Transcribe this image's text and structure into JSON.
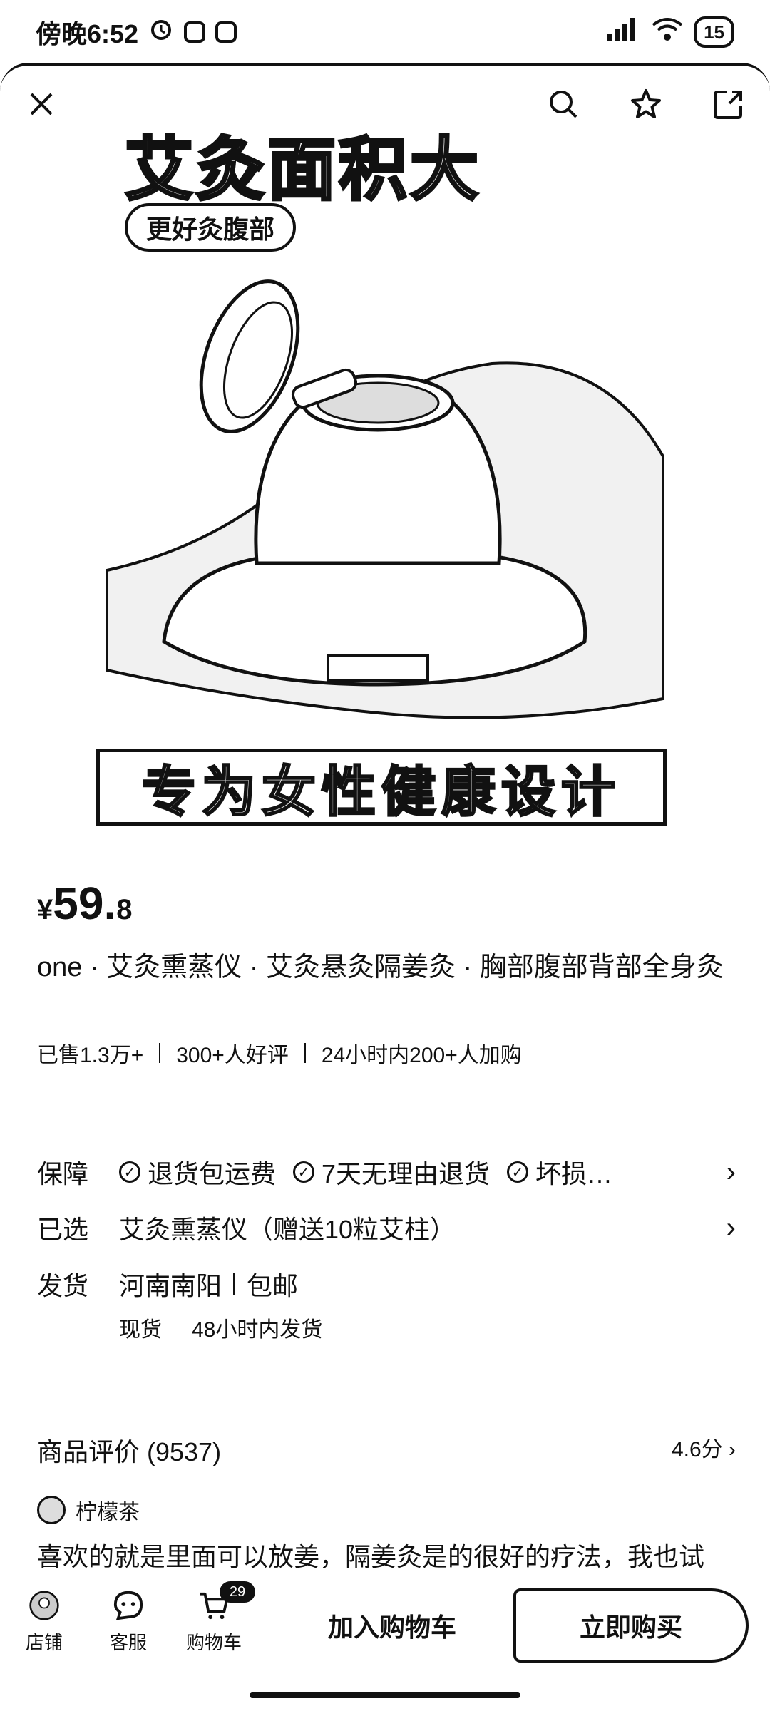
{
  "status_bar": {
    "time": "傍晚6:52",
    "battery": "15"
  },
  "hero": {
    "title": "艾灸面积大",
    "tag": "更好灸腹部",
    "banner": "专为女性健康设计"
  },
  "price": {
    "currency": "¥",
    "integer": "59.",
    "decimal": "8"
  },
  "product": {
    "title": "one · 艾灸熏蒸仪 · 艾灸悬灸隔姜灸 · 胸部腹部背部全身灸",
    "sold": "已售1.3万+",
    "good_reviews": "300+人好评",
    "added_24h": "24小时内200+人加购"
  },
  "guarantee": {
    "label": "保障",
    "items": [
      "退货包运费",
      "7天无理由退货",
      "坏损…"
    ]
  },
  "selected": {
    "label": "已选",
    "value": "艾灸熏蒸仪（赠送10粒艾柱）"
  },
  "shipping": {
    "label": "发货",
    "origin": "河南南阳",
    "fee": "包邮",
    "stock": "现货",
    "ship_time": "48小时内发货"
  },
  "reviews": {
    "title": "商品评价 (9537)",
    "score": "4.6分",
    "reviewer": "柠檬茶",
    "text": "喜欢的就是里面可以放姜，隔姜灸是的很好的疗法，我也试"
  },
  "bottom_bar": {
    "store": "店铺",
    "service": "客服",
    "cart": "购物车",
    "cart_count": "29",
    "add_to_cart": "加入购物车",
    "buy_now": "立即购买"
  }
}
